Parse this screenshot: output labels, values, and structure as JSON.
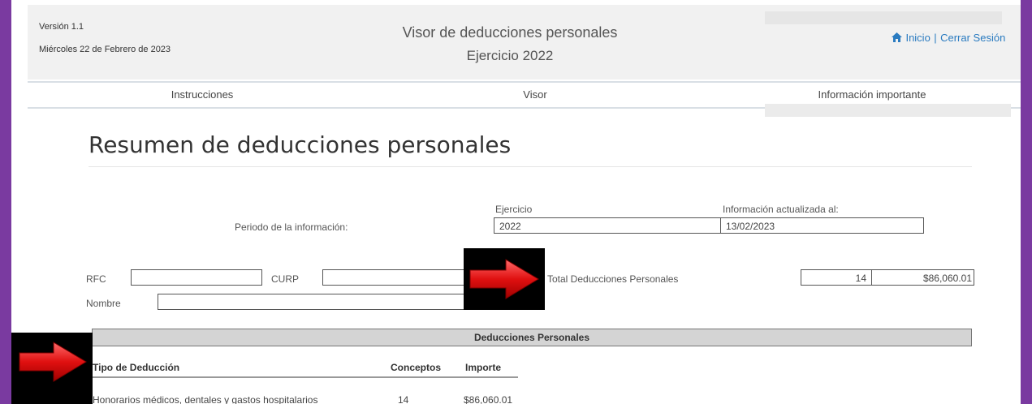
{
  "header": {
    "version": "Versión 1.1",
    "date": "Miércoles 22 de Febrero de 2023",
    "title_line1": "Visor de deducciones personales",
    "title_line2": "Ejercicio 2022",
    "home_link": "Inicio",
    "separator": "|",
    "logout_link": "Cerrar Sesión"
  },
  "nav": {
    "items": [
      {
        "label": "Instrucciones"
      },
      {
        "label": "Visor"
      },
      {
        "label": "Información importante"
      }
    ]
  },
  "main": {
    "page_title": "Resumen de deducciones personales",
    "period_label": "Periodo de la información:",
    "ejercicio_label": "Ejercicio",
    "ejercicio_value": "2022",
    "updated_label": "Información actualizada al:",
    "updated_value": "13/02/2023",
    "rfc_label": "RFC",
    "rfc_value": "",
    "curp_label": "CURP",
    "curp_value": "",
    "nombre_label": "Nombre",
    "nombre_value": "",
    "total_label": "Total Deducciones Personales",
    "total_count": "14",
    "total_amount": "$86,060.01"
  },
  "table": {
    "caption": "Deducciones Personales",
    "headers": [
      "Tipo de Deducción",
      "Conceptos",
      "Importe"
    ],
    "rows": [
      [
        "Honorarios médicos, dentales y gastos hospitalarios",
        "14",
        "$86,060.01"
      ]
    ]
  },
  "colors": {
    "frame_border": "#7a3aa0",
    "link": "#2a7bc0",
    "arrow": "#e01010"
  }
}
